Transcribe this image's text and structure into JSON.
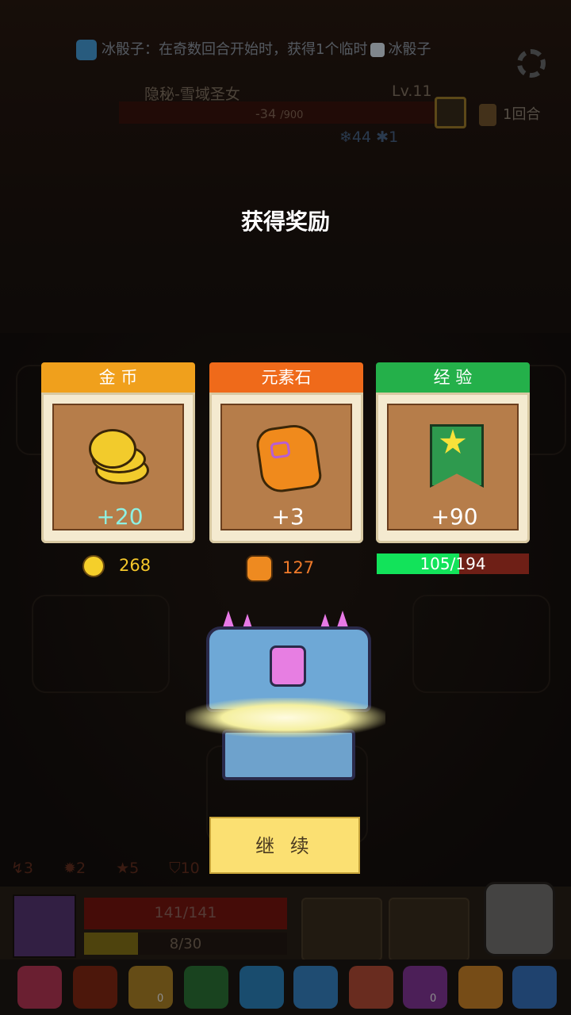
{
  "top_bar": {
    "buff_text": "冰骰子：在奇数回合开始时，获得1个临时",
    "buff_suffix": "冰骰子",
    "enemy_name": "隐秘-雪域圣女",
    "enemy_level": "Lv.11",
    "enemy_hp": "-34",
    "enemy_hp_max": "/900",
    "enemy_stat_ice": "44",
    "enemy_stat_other": "1",
    "round_label": "1回合"
  },
  "reward": {
    "title": "获得奖励",
    "cards": [
      {
        "head": "金 币",
        "amount": "+20",
        "color": "#f0a01c",
        "icon": "gold-coins-icon"
      },
      {
        "head": "元素石",
        "amount": "+3",
        "color": "#ef6a1a",
        "icon": "element-stone-icon"
      },
      {
        "head": "经 验",
        "amount": "+90",
        "color": "#24b04a",
        "icon": "exp-flag-icon"
      }
    ],
    "gold_total": "268",
    "stone_total": "127",
    "xp_text": "105/194",
    "xp_progress": 0.541,
    "continue_label": "继 续"
  },
  "player": {
    "stats": [
      "3",
      "2",
      "5",
      "10"
    ],
    "hp_text": "141/141",
    "mp_text": "8/30",
    "mp_progress": 0.267
  },
  "inventory": {
    "badge_a": "0",
    "badge_b": "0"
  }
}
